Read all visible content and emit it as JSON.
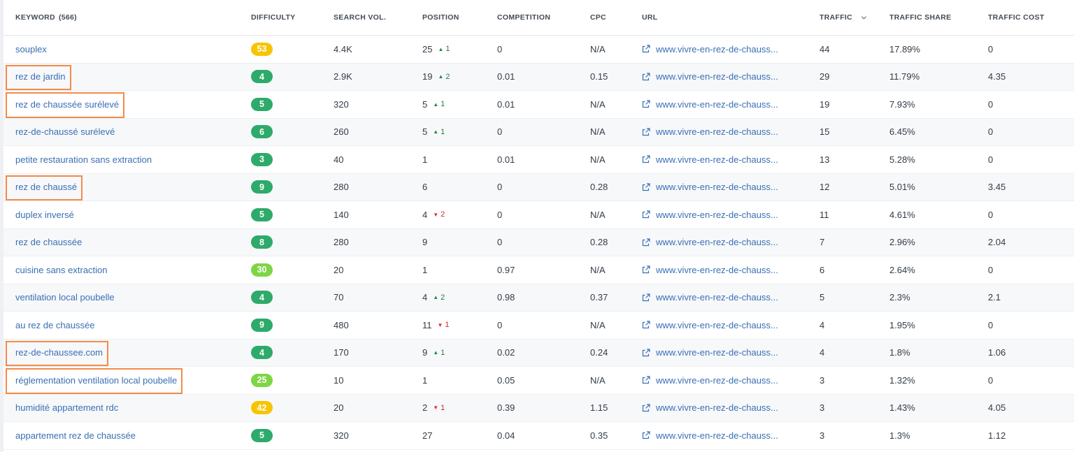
{
  "header": {
    "keyword_label": "KEYWORD",
    "keyword_count": "(566)",
    "difficulty": "DIFFICULTY",
    "search_vol": "SEARCH VOL.",
    "position": "POSITION",
    "competition": "COMPETITION",
    "cpc": "CPC",
    "url": "URL",
    "traffic": "TRAFFIC",
    "traffic_share": "TRAFFIC SHARE",
    "traffic_cost": "TRAFFIC COST"
  },
  "colors": {
    "green": "#2eaa6b",
    "lightgreen": "#7ed545",
    "yellow": "#f7c400",
    "highlight": "#f28b4a",
    "link": "#3a6fb5"
  },
  "rows": [
    {
      "keyword": "souplex",
      "difficulty": "53",
      "diff_color": "yellow",
      "volume": "4.4K",
      "position": "25",
      "change_dir": "up",
      "change": "1",
      "competition": "0",
      "cpc": "N/A",
      "url": "www.vivre-en-rez-de-chauss...",
      "traffic": "44",
      "share": "17.89%",
      "cost": "0",
      "highlighted": false
    },
    {
      "keyword": "rez de jardin",
      "difficulty": "4",
      "diff_color": "green",
      "volume": "2.9K",
      "position": "19",
      "change_dir": "up",
      "change": "2",
      "competition": "0.01",
      "cpc": "0.15",
      "url": "www.vivre-en-rez-de-chauss...",
      "traffic": "29",
      "share": "11.79%",
      "cost": "4.35",
      "highlighted": true
    },
    {
      "keyword": "rez de chaussée surélevé",
      "difficulty": "5",
      "diff_color": "green",
      "volume": "320",
      "position": "5",
      "change_dir": "up",
      "change": "1",
      "competition": "0.01",
      "cpc": "N/A",
      "url": "www.vivre-en-rez-de-chauss...",
      "traffic": "19",
      "share": "7.93%",
      "cost": "0",
      "highlighted": true
    },
    {
      "keyword": "rez-de-chaussé surélevé",
      "difficulty": "6",
      "diff_color": "green",
      "volume": "260",
      "position": "5",
      "change_dir": "up",
      "change": "1",
      "competition": "0",
      "cpc": "N/A",
      "url": "www.vivre-en-rez-de-chauss...",
      "traffic": "15",
      "share": "6.45%",
      "cost": "0",
      "highlighted": false
    },
    {
      "keyword": "petite restauration sans extraction",
      "difficulty": "3",
      "diff_color": "green",
      "volume": "40",
      "position": "1",
      "change_dir": "",
      "change": "",
      "competition": "0.01",
      "cpc": "N/A",
      "url": "www.vivre-en-rez-de-chauss...",
      "traffic": "13",
      "share": "5.28%",
      "cost": "0",
      "highlighted": false
    },
    {
      "keyword": "rez de chaussé",
      "difficulty": "9",
      "diff_color": "green",
      "volume": "280",
      "position": "6",
      "change_dir": "",
      "change": "",
      "competition": "0",
      "cpc": "0.28",
      "url": "www.vivre-en-rez-de-chauss...",
      "traffic": "12",
      "share": "5.01%",
      "cost": "3.45",
      "highlighted": true
    },
    {
      "keyword": "duplex inversé",
      "difficulty": "5",
      "diff_color": "green",
      "volume": "140",
      "position": "4",
      "change_dir": "down",
      "change": "2",
      "competition": "0",
      "cpc": "N/A",
      "url": "www.vivre-en-rez-de-chauss...",
      "traffic": "11",
      "share": "4.61%",
      "cost": "0",
      "highlighted": false
    },
    {
      "keyword": "rez de chaussée",
      "difficulty": "8",
      "diff_color": "green",
      "volume": "280",
      "position": "9",
      "change_dir": "",
      "change": "",
      "competition": "0",
      "cpc": "0.28",
      "url": "www.vivre-en-rez-de-chauss...",
      "traffic": "7",
      "share": "2.96%",
      "cost": "2.04",
      "highlighted": false
    },
    {
      "keyword": "cuisine sans extraction",
      "difficulty": "30",
      "diff_color": "lightgreen",
      "volume": "20",
      "position": "1",
      "change_dir": "",
      "change": "",
      "competition": "0.97",
      "cpc": "N/A",
      "url": "www.vivre-en-rez-de-chauss...",
      "traffic": "6",
      "share": "2.64%",
      "cost": "0",
      "highlighted": false
    },
    {
      "keyword": "ventilation local poubelle",
      "difficulty": "4",
      "diff_color": "green",
      "volume": "70",
      "position": "4",
      "change_dir": "up",
      "change": "2",
      "competition": "0.98",
      "cpc": "0.37",
      "url": "www.vivre-en-rez-de-chauss...",
      "traffic": "5",
      "share": "2.3%",
      "cost": "2.1",
      "highlighted": false
    },
    {
      "keyword": "au rez de chaussée",
      "difficulty": "9",
      "diff_color": "green",
      "volume": "480",
      "position": "11",
      "change_dir": "down",
      "change": "1",
      "competition": "0",
      "cpc": "N/A",
      "url": "www.vivre-en-rez-de-chauss...",
      "traffic": "4",
      "share": "1.95%",
      "cost": "0",
      "highlighted": false
    },
    {
      "keyword": "rez-de-chaussee.com",
      "difficulty": "4",
      "diff_color": "green",
      "volume": "170",
      "position": "9",
      "change_dir": "up",
      "change": "1",
      "competition": "0.02",
      "cpc": "0.24",
      "url": "www.vivre-en-rez-de-chauss...",
      "traffic": "4",
      "share": "1.8%",
      "cost": "1.06",
      "highlighted": true
    },
    {
      "keyword": "réglementation ventilation local poubelle",
      "difficulty": "25",
      "diff_color": "lightgreen",
      "volume": "10",
      "position": "1",
      "change_dir": "",
      "change": "",
      "competition": "0.05",
      "cpc": "N/A",
      "url": "www.vivre-en-rez-de-chauss...",
      "traffic": "3",
      "share": "1.32%",
      "cost": "0",
      "highlighted": true
    },
    {
      "keyword": "humidité appartement rdc",
      "difficulty": "42",
      "diff_color": "yellow",
      "volume": "20",
      "position": "2",
      "change_dir": "down",
      "change": "1",
      "competition": "0.39",
      "cpc": "1.15",
      "url": "www.vivre-en-rez-de-chauss...",
      "traffic": "3",
      "share": "1.43%",
      "cost": "4.05",
      "highlighted": false
    },
    {
      "keyword": "appartement rez de chaussée",
      "difficulty": "5",
      "diff_color": "green",
      "volume": "320",
      "position": "27",
      "change_dir": "",
      "change": "",
      "competition": "0.04",
      "cpc": "0.35",
      "url": "www.vivre-en-rez-de-chauss...",
      "traffic": "3",
      "share": "1.3%",
      "cost": "1.12",
      "highlighted": false
    }
  ]
}
